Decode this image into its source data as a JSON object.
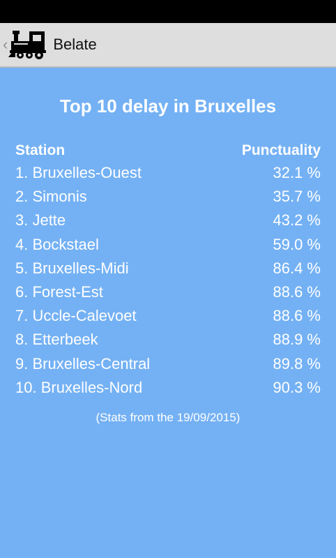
{
  "app": {
    "title": "Belate",
    "up_icon": "train-icon"
  },
  "heading": "Top 10 delay in Bruxelles",
  "table": {
    "headers": {
      "station": "Station",
      "punctuality": "Punctuality"
    },
    "rows": [
      {
        "station": "1. Bruxelles-Ouest",
        "punctuality": "32.1 %"
      },
      {
        "station": "2. Simonis",
        "punctuality": "35.7 %"
      },
      {
        "station": "3. Jette",
        "punctuality": "43.2 %"
      },
      {
        "station": "4. Bockstael",
        "punctuality": "59.0 %"
      },
      {
        "station": "5. Bruxelles-Midi",
        "punctuality": "86.4 %"
      },
      {
        "station": "6. Forest-Est",
        "punctuality": "88.6 %"
      },
      {
        "station": "7. Uccle-Calevoet",
        "punctuality": "88.6 %"
      },
      {
        "station": "8. Etterbeek",
        "punctuality": "88.9 %"
      },
      {
        "station": "9. Bruxelles-Central",
        "punctuality": "89.8 %"
      },
      {
        "station": "10. Bruxelles-Nord",
        "punctuality": "90.3 %"
      }
    ]
  },
  "footnote": "(Stats from the 19/09/2015)",
  "colors": {
    "background": "#74b1f4",
    "action_bar": "#dedede",
    "status_bar": "#000000",
    "text": "#ffffff"
  }
}
